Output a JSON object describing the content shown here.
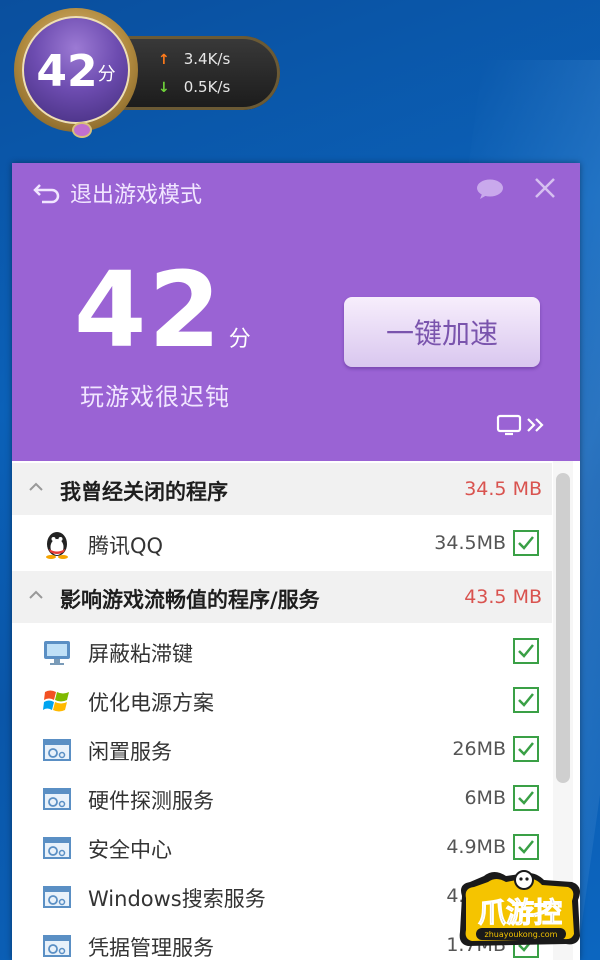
{
  "widget": {
    "score": "42",
    "score_unit": "分",
    "upload_speed": "3.4K/s",
    "download_speed": "0.5K/s"
  },
  "panel": {
    "exit_label": "退出游戏模式",
    "score": "42",
    "score_unit": "分",
    "score_desc": "玩游戏很迟钝",
    "boost_button": "一键加速"
  },
  "groups": [
    {
      "title": "我曾经关闭的程序",
      "size": "34.5 MB",
      "items": [
        {
          "name": "腾讯QQ",
          "size": "34.5MB",
          "icon": "qq-penguin-icon",
          "checked": true
        }
      ]
    },
    {
      "title": "影响游戏流畅值的程序/服务",
      "size": "43.5 MB",
      "items": [
        {
          "name": "屏蔽粘滞键",
          "size": "",
          "icon": "monitor-icon",
          "checked": true
        },
        {
          "name": "优化电源方案",
          "size": "",
          "icon": "windows-flag-icon",
          "checked": true
        },
        {
          "name": "闲置服务",
          "size": "26MB",
          "icon": "service-window-icon",
          "checked": true
        },
        {
          "name": "硬件探测服务",
          "size": "6MB",
          "icon": "service-window-icon",
          "checked": true
        },
        {
          "name": "安全中心",
          "size": "4.9MB",
          "icon": "service-window-icon",
          "checked": true
        },
        {
          "name": "Windows搜索服务",
          "size": "4.7MB",
          "icon": "service-window-icon",
          "checked": true
        },
        {
          "name": "凭据管理服务",
          "size": "1.7MB",
          "icon": "service-window-icon",
          "checked": true
        }
      ]
    }
  ],
  "watermark": {
    "brand": "爪游控",
    "url": "zhuayoukong.com"
  },
  "colors": {
    "header_purple": "#9a63d4",
    "check_green": "#3aa046",
    "size_red": "#d9534f"
  }
}
